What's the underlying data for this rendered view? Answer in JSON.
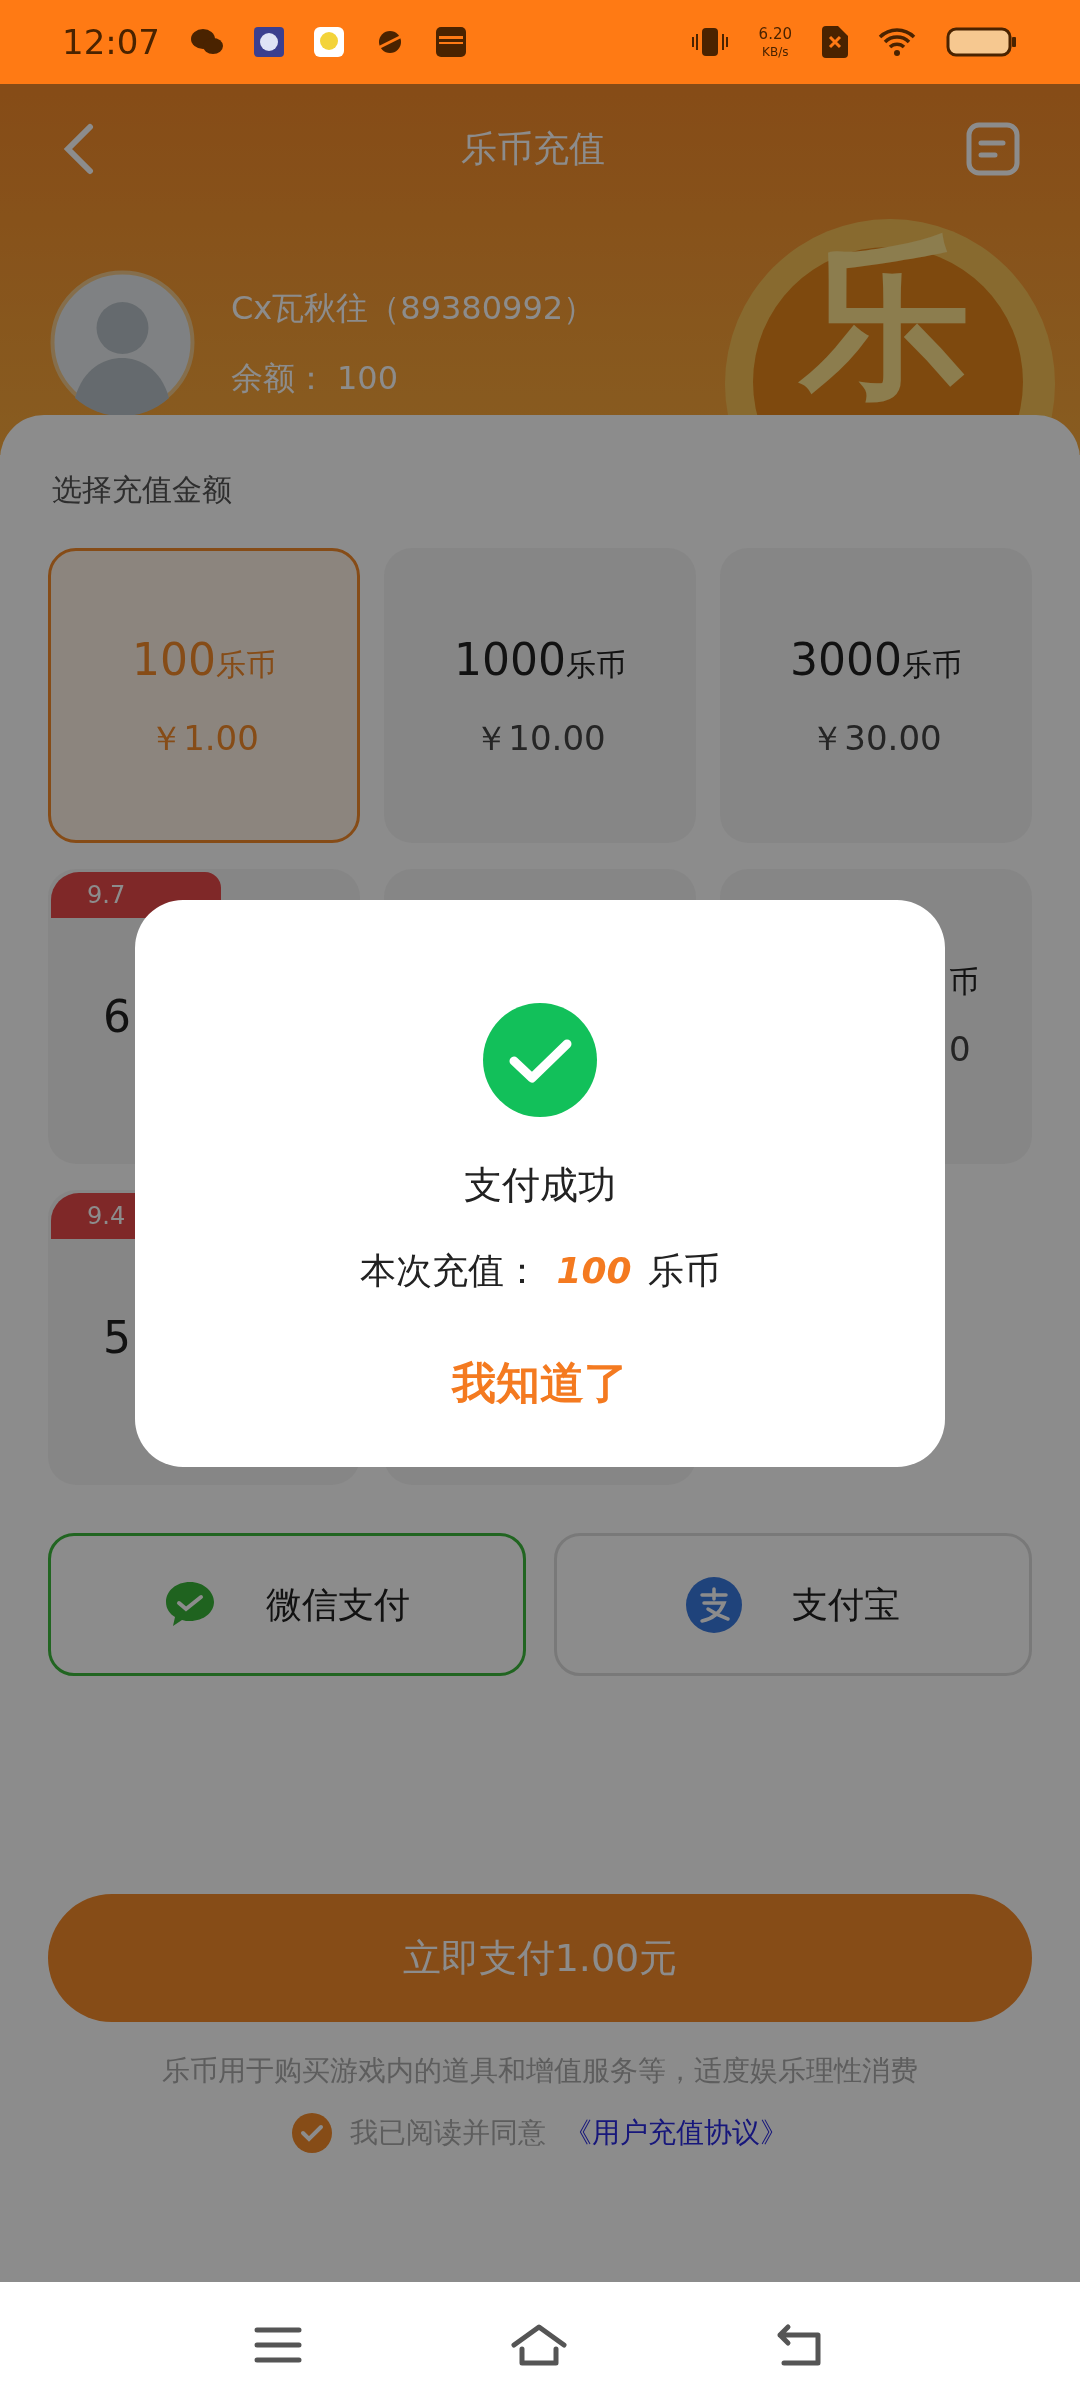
{
  "status_bar": {
    "time": "12:07",
    "net_speed": "6.20",
    "net_unit": "KB/s"
  },
  "header": {
    "title": "乐币充值",
    "coin_glyph": "乐"
  },
  "profile": {
    "name": "Cx瓦秋往（89380992）",
    "balance_label": "余额：",
    "balance": "100"
  },
  "amount_section": {
    "title": "选择充值金额"
  },
  "packages": [
    {
      "amount": "100",
      "unit": "乐币",
      "price": "￥1.00",
      "selected": true
    },
    {
      "amount": "1000",
      "unit": "乐币",
      "price": "￥10.00",
      "selected": false
    },
    {
      "amount": "3000",
      "unit": "乐币",
      "price": "￥30.00",
      "selected": false
    },
    {
      "badge": "9.7",
      "amount": "6",
      "selected": false
    },
    {
      "selected": false
    },
    {
      "unit": "币",
      "price": "0",
      "selected": false
    },
    {
      "badge": "9.4",
      "amount": "5",
      "selected": false
    },
    {
      "selected": false
    }
  ],
  "payments": [
    {
      "kind": "wechat",
      "label": "微信支付",
      "selected": true
    },
    {
      "kind": "alipay",
      "label": "支付宝",
      "selected": false
    }
  ],
  "pay_button": "立即支付1.00元",
  "note": "乐币用于购买游戏内的道具和增值服务等，适度娱乐理性消费",
  "agreement": {
    "checked": true,
    "text": "我已阅读并同意",
    "link": "《用户充值协议》"
  },
  "dialog": {
    "title": "支付成功",
    "label": "本次充值：",
    "amount": "100",
    "unit": "乐币",
    "button": "我知道了"
  }
}
